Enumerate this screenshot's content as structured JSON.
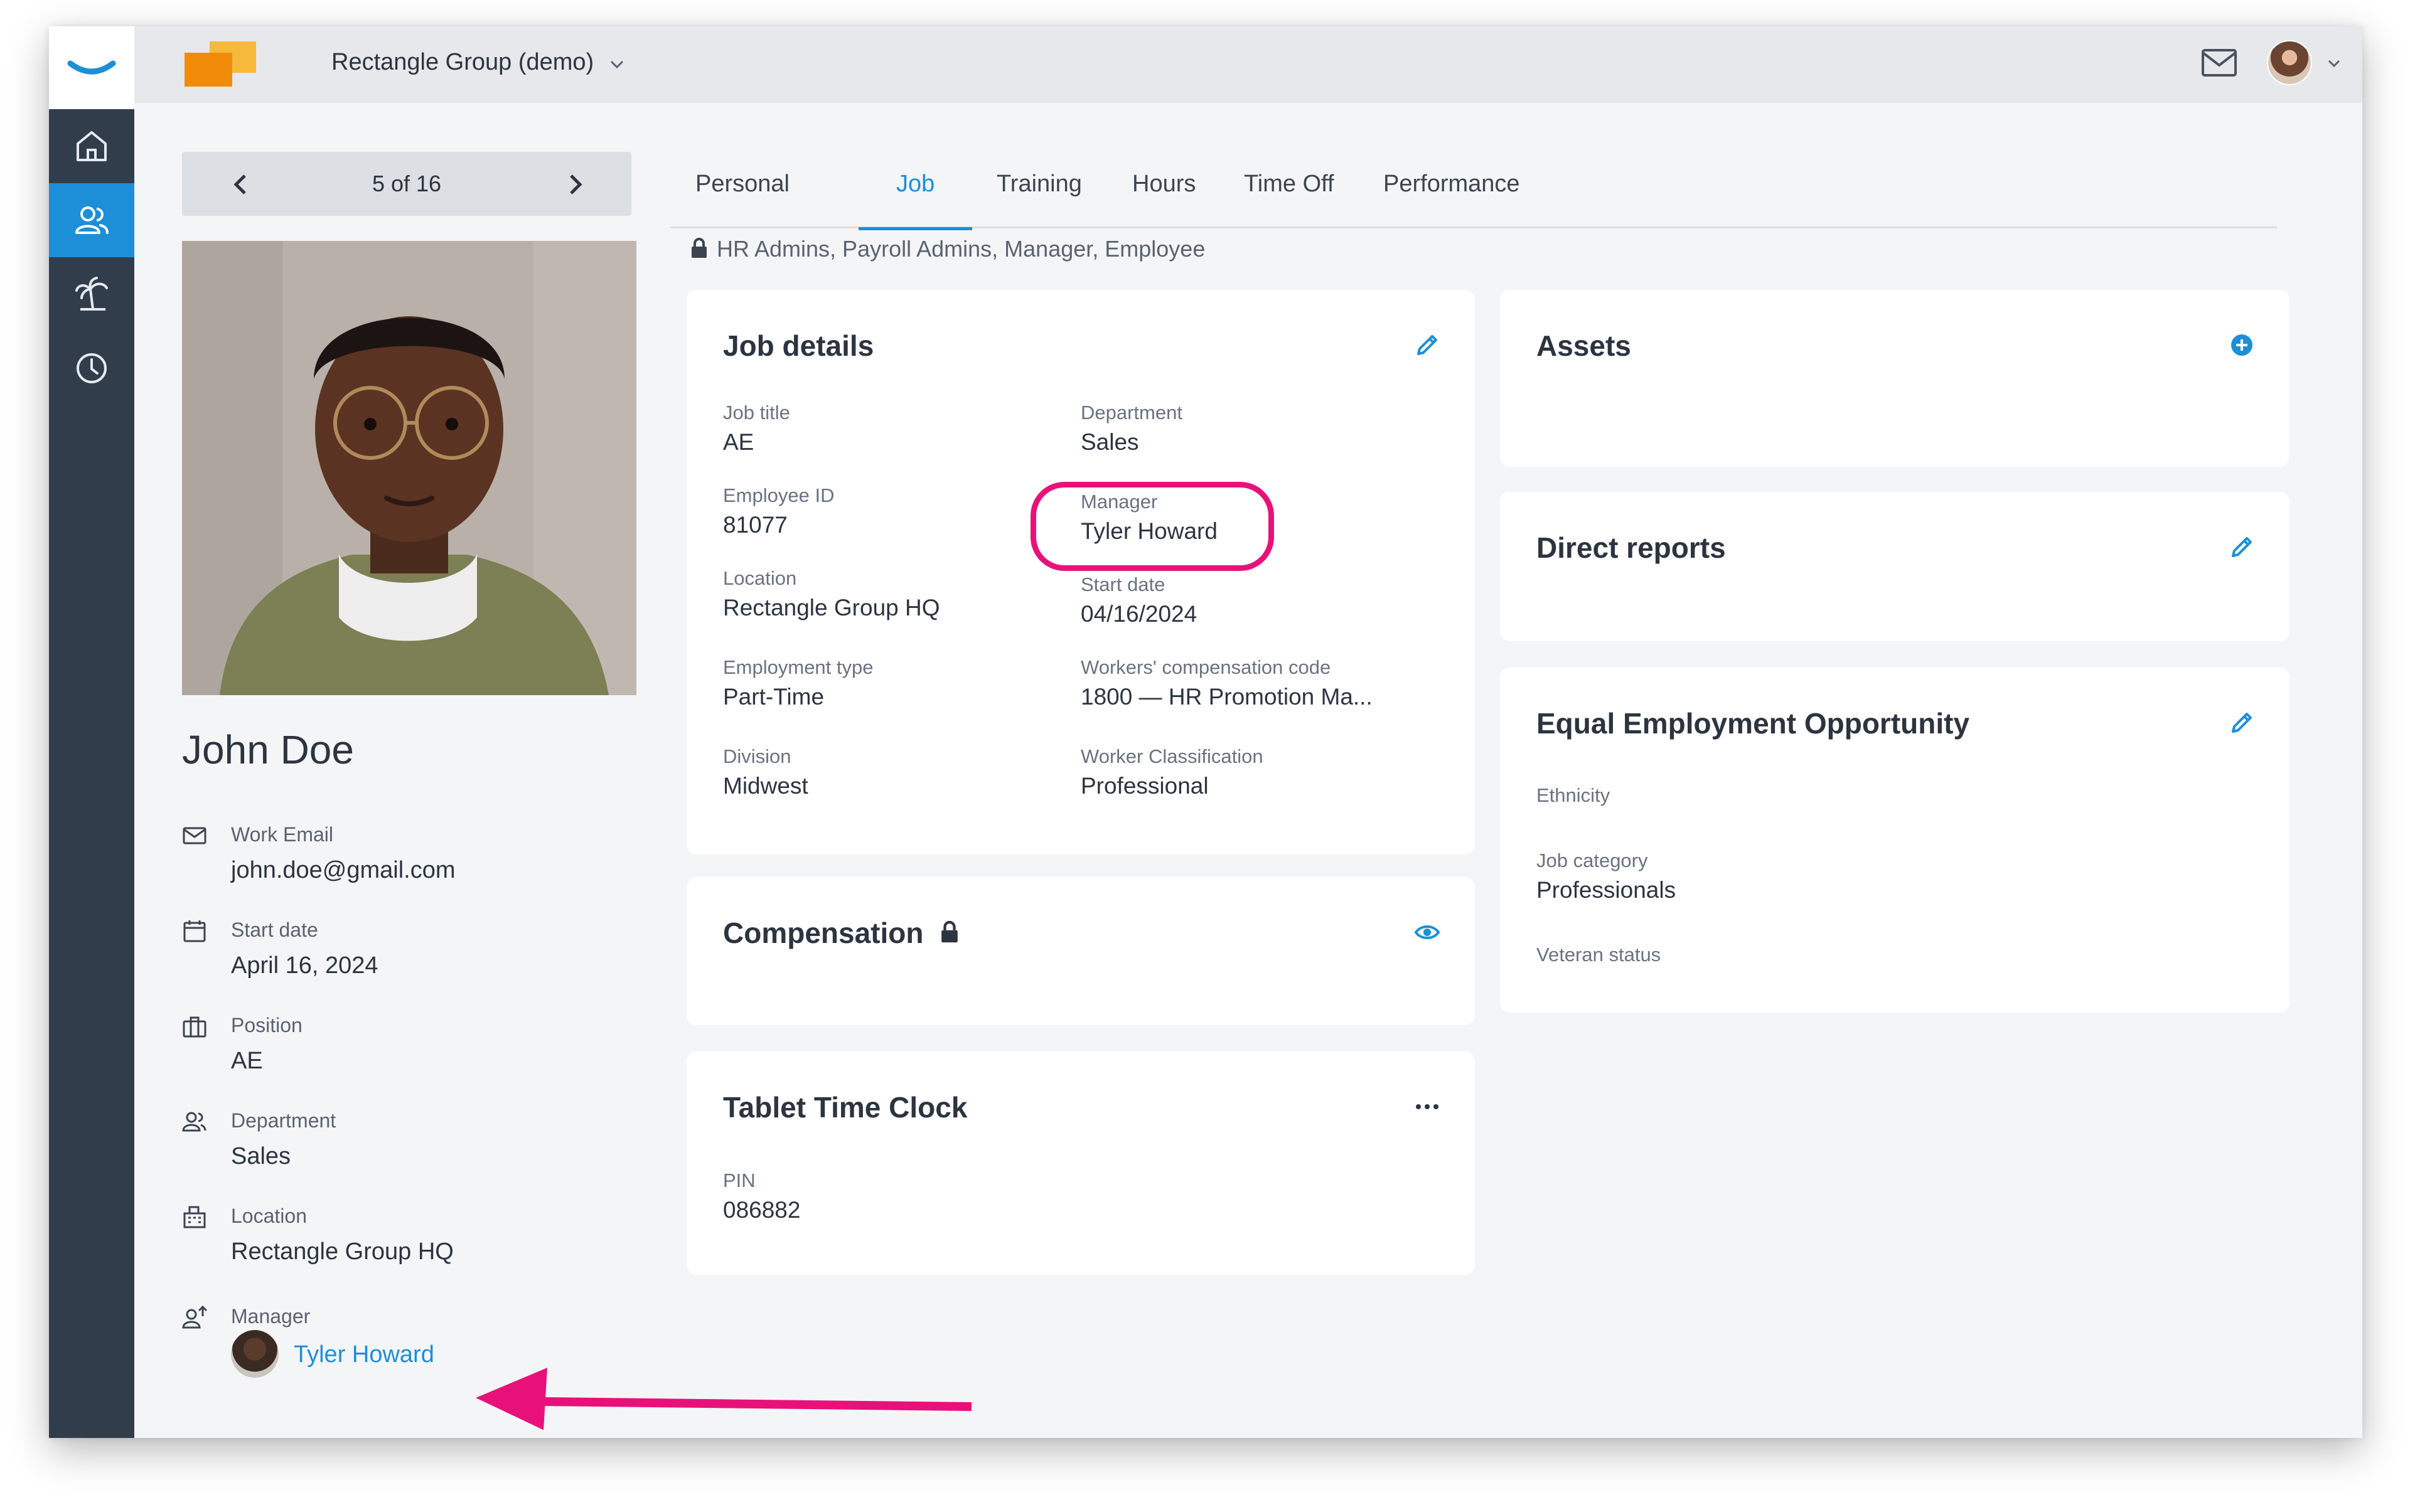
{
  "topbar": {
    "company_name": "Rectangle Group (demo)",
    "icons": [
      "mail-icon",
      "user-avatar",
      "chevron-down-icon"
    ]
  },
  "sidebar": {
    "items": [
      {
        "icon": "home-icon",
        "active": false
      },
      {
        "icon": "people-icon",
        "active": true
      },
      {
        "icon": "palm-tree-icon",
        "active": false
      },
      {
        "icon": "clock-icon",
        "active": false
      }
    ]
  },
  "profile": {
    "pager_text": "5 of 16",
    "name": "John Doe",
    "work_email_label": "Work Email",
    "work_email": "john.doe@gmail.com",
    "start_date_label": "Start date",
    "start_date": "April 16, 2024",
    "position_label": "Position",
    "position": "AE",
    "department_label": "Department",
    "department": "Sales",
    "location_label": "Location",
    "location": "Rectangle Group HQ",
    "manager_label": "Manager",
    "manager": "Tyler Howard"
  },
  "tabs": [
    "Personal",
    "Job",
    "Training",
    "Hours",
    "Time Off",
    "Performance"
  ],
  "active_tab": "Job",
  "permissions": "HR Admins, Payroll Admins, Manager, Employee",
  "job_details": {
    "title": "Job details",
    "job_title_label": "Job title",
    "job_title": "AE",
    "department_label": "Department",
    "department": "Sales",
    "employee_id_label": "Employee ID",
    "employee_id": "81077",
    "manager_label": "Manager",
    "manager": "Tyler Howard",
    "location_label": "Location",
    "location": "Rectangle Group HQ",
    "start_date_label": "Start date",
    "start_date": "04/16/2024",
    "employment_type_label": "Employment type",
    "employment_type": "Part-Time",
    "comp_code_label": "Workers' compensation code",
    "comp_code": "1800 — HR Promotion Ma...",
    "division_label": "Division",
    "division": "Midwest",
    "classification_label": "Worker Classification",
    "classification": "Professional"
  },
  "compensation": {
    "title": "Compensation"
  },
  "time_clock": {
    "title": "Tablet Time Clock",
    "pin_label": "PIN",
    "pin": "086882"
  },
  "assets": {
    "title": "Assets"
  },
  "direct_reports": {
    "title": "Direct reports"
  },
  "eeo": {
    "title": "Equal Employment Opportunity",
    "ethnicity_label": "Ethnicity",
    "job_category_label": "Job category",
    "job_category": "Professionals",
    "veteran_label": "Veteran status"
  },
  "colors": {
    "accent": "#1c8fd6",
    "sidebar": "#323d4c",
    "highlight": "#e8117a",
    "logo_orange": "#f0a019"
  }
}
